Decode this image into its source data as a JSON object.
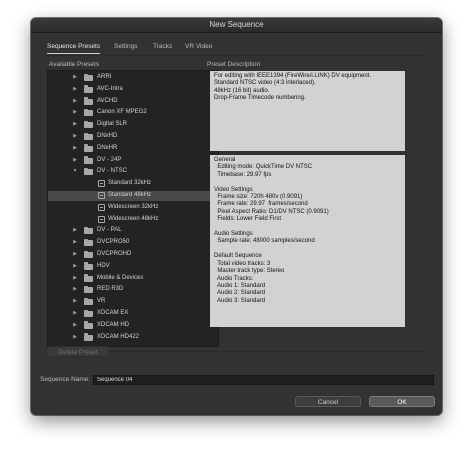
{
  "window": {
    "title": "New Sequence"
  },
  "tabs": [
    {
      "label": "Sequence Presets",
      "active": true
    },
    {
      "label": "Settings",
      "active": false
    },
    {
      "label": "Tracks",
      "active": false
    },
    {
      "label": "VR Video",
      "active": false
    }
  ],
  "presets": {
    "header": "Available Presets",
    "items": [
      {
        "label": "ARRI",
        "type": "folder",
        "expanded": false
      },
      {
        "label": "AVC-Intra",
        "type": "folder",
        "expanded": false
      },
      {
        "label": "AVCHD",
        "type": "folder",
        "expanded": false
      },
      {
        "label": "Canon XF MPEG2",
        "type": "folder",
        "expanded": false
      },
      {
        "label": "Digital SLR",
        "type": "folder",
        "expanded": false
      },
      {
        "label": "DNxHD",
        "type": "folder",
        "expanded": false
      },
      {
        "label": "DNxHR",
        "type": "folder",
        "expanded": false
      },
      {
        "label": "DV - 24P",
        "type": "folder",
        "expanded": false
      },
      {
        "label": "DV - NTSC",
        "type": "folder",
        "expanded": true
      },
      {
        "label": "Standard 32kHz",
        "type": "file",
        "selected": false
      },
      {
        "label": "Standard 48kHz",
        "type": "file",
        "selected": true
      },
      {
        "label": "Widescreen 32kHz",
        "type": "file",
        "selected": false
      },
      {
        "label": "Widescreen 48kHz",
        "type": "file",
        "selected": false
      },
      {
        "label": "DV - PAL",
        "type": "folder",
        "expanded": false
      },
      {
        "label": "DVCPRO50",
        "type": "folder",
        "expanded": false
      },
      {
        "label": "DVCPROHD",
        "type": "folder",
        "expanded": false
      },
      {
        "label": "HDV",
        "type": "folder",
        "expanded": false
      },
      {
        "label": "Mobile & Devices",
        "type": "folder",
        "expanded": false
      },
      {
        "label": "RED R3D",
        "type": "folder",
        "expanded": false
      },
      {
        "label": "VR",
        "type": "folder",
        "expanded": false
      },
      {
        "label": "XDCAM EX",
        "type": "folder",
        "expanded": false
      },
      {
        "label": "XDCAM HD",
        "type": "folder",
        "expanded": false
      },
      {
        "label": "XDCAM HD422",
        "type": "folder",
        "expanded": false
      }
    ]
  },
  "description": {
    "header": "Preset Description",
    "summary": "For editing with IEEE1394 (FireWire/i.LINK) DV equipment.\nStandard NTSC video (4:3 interlaced).\n48kHz (16 bit) audio.\nDrop-Frame Timecode numbering.",
    "details": "General\n  Editing mode: QuickTime DV NTSC\n  Timebase: 29.97 fps\n\nVideo Settings\n  Frame size: 720h 480v (0.9091)\n  Frame rate: 29.97  frames/second\n  Pixel Aspect Ratio: D1/DV NTSC (0.9091)\n  Fields: Lower Field First\n\nAudio Settings\n  Sample rate: 48000 samples/second\n\nDefault Sequence\n  Total video tracks: 3\n  Master track type: Stereo\n  Audio Tracks:\n  Audio 1: Standard\n  Audio 2: Standard\n  Audio 3: Standard"
  },
  "buttons": {
    "delete_preset": "Delete Preset",
    "cancel": "Cancel",
    "ok": "OK"
  },
  "sequence_name": {
    "label": "Sequence Name:",
    "value": "Sequence 04"
  }
}
